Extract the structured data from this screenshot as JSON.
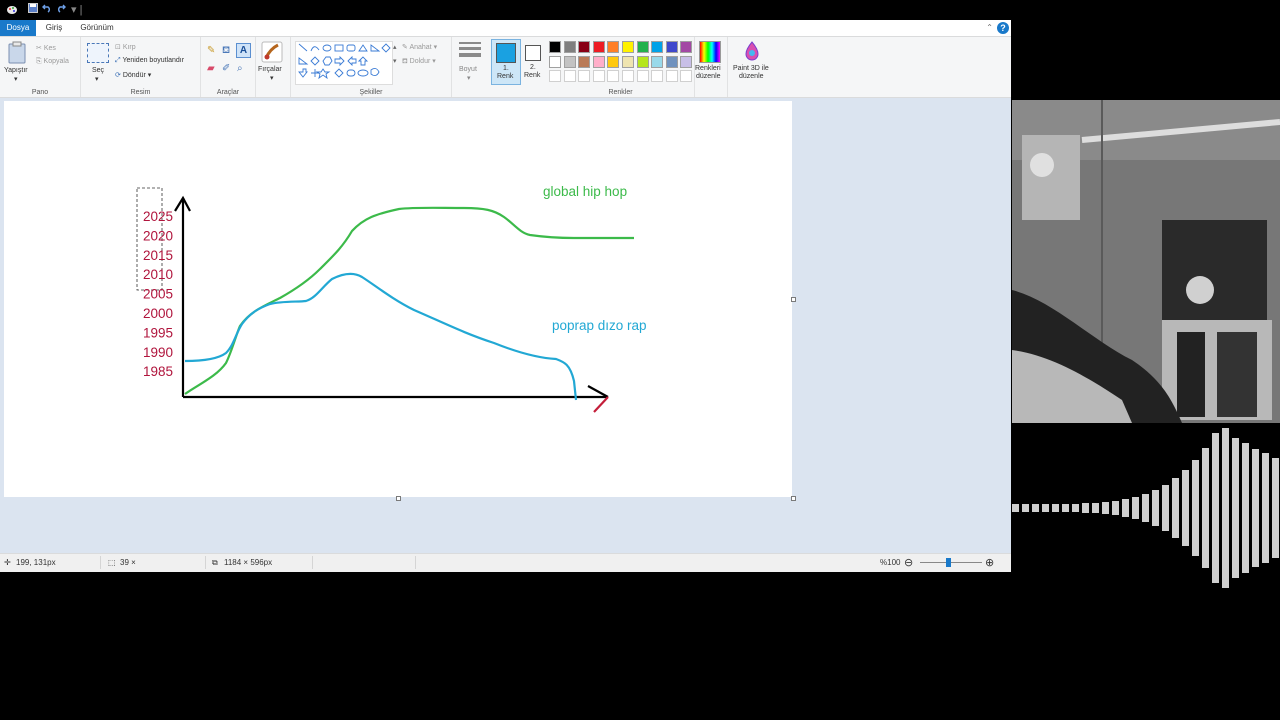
{
  "window": {
    "menu_tabs": [
      "Dosya",
      "Giriş",
      "Görünüm"
    ],
    "help_icon": "help-icon"
  },
  "ribbon": {
    "pano": {
      "label": "Pano",
      "paste": "Yapıştır",
      "cut": "Kes",
      "copy": "Kopyala"
    },
    "resim": {
      "label": "Resim",
      "select": "Seç",
      "crop": "Kırp",
      "resize": "Yeniden boyutlandır",
      "rotate": "Döndür"
    },
    "araclar": {
      "label": "Araçlar"
    },
    "fircalar": {
      "label": "Fırçalar"
    },
    "sekiller": {
      "label": "Şekiller",
      "outline": "Anahat",
      "fill": "Doldur"
    },
    "boyut": {
      "label": "Boyut"
    },
    "color1": {
      "label1": "1.",
      "label2": "Renk",
      "color": "#1aa1e1"
    },
    "color2": {
      "label1": "2.",
      "label2": "Renk",
      "color": "#ffffff"
    },
    "renkler": {
      "label": "Renkler"
    },
    "edit_colors": {
      "label1": "Renkleri",
      "label2": "düzenle"
    },
    "paint3d": {
      "label1": "Paint 3D ile",
      "label2": "düzenle"
    },
    "palette_row1": [
      "#000000",
      "#7f7f7f",
      "#880015",
      "#ed1c24",
      "#ff7f27",
      "#fff200",
      "#22b14c",
      "#00a2e8",
      "#3f48cc",
      "#a349a4"
    ],
    "palette_row2": [
      "#ffffff",
      "#c3c3c3",
      "#b97a57",
      "#ffaec9",
      "#ffc90e",
      "#efe4b0",
      "#b5e61d",
      "#99d9ea",
      "#7092be",
      "#c8bfe7"
    ],
    "palette_row3": [
      "#ffffff",
      "#ffffff",
      "#ffffff",
      "#ffffff",
      "#ffffff",
      "#ffffff",
      "#ffffff",
      "#ffffff",
      "#ffffff",
      "#ffffff"
    ]
  },
  "drawing": {
    "years": [
      "2025",
      "2020",
      "2015",
      "2010",
      "2005",
      "2000",
      "1995",
      "1990",
      "1985"
    ],
    "green_label": "global hip hop",
    "blue_label": "poprap dızo rap",
    "colors": {
      "years": "#b0143c",
      "green": "#3cba4a",
      "blue": "#22a8d4",
      "axis": "#000000",
      "arrow_accent": "#c41e3a"
    }
  },
  "status": {
    "cursor_pos": "199, 131px",
    "selection_size": "39 ×",
    "canvas_size": "1184 × 596px",
    "zoom": "%100"
  }
}
